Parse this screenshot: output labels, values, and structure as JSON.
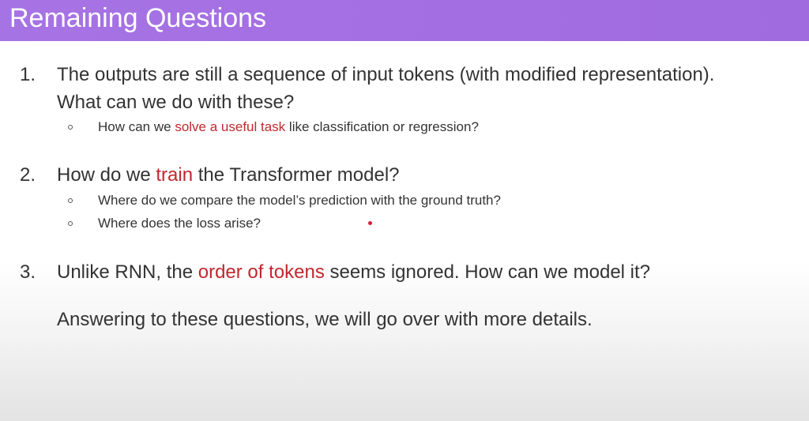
{
  "slide": {
    "title": "Remaining Questions",
    "questions": [
      {
        "number": "1.",
        "line1": "The outputs are still a sequence of input tokens (with modified representation).",
        "line2": "What can we do with these?",
        "subs": [
          {
            "pre": "How can we ",
            "highlight": "solve a useful task",
            "post": " like classification or regression?"
          }
        ]
      },
      {
        "number": "2.",
        "pre": "How do we ",
        "highlight": "train",
        "post": " the Transformer model?",
        "subs": [
          {
            "text": "Where do we compare the model’s prediction with the ground truth?"
          },
          {
            "text": "Where does the loss arise?"
          }
        ]
      },
      {
        "number": "3.",
        "pre": "Unlike RNN, the ",
        "highlight": "order of tokens",
        "post": " seems ignored. How can we model it?"
      }
    ],
    "closing": "Answering to these questions, we will go over with more details."
  },
  "colors": {
    "title_bar": "#a36ee2",
    "highlight": "#c0282d",
    "pointer_dot": "#d4203a"
  }
}
